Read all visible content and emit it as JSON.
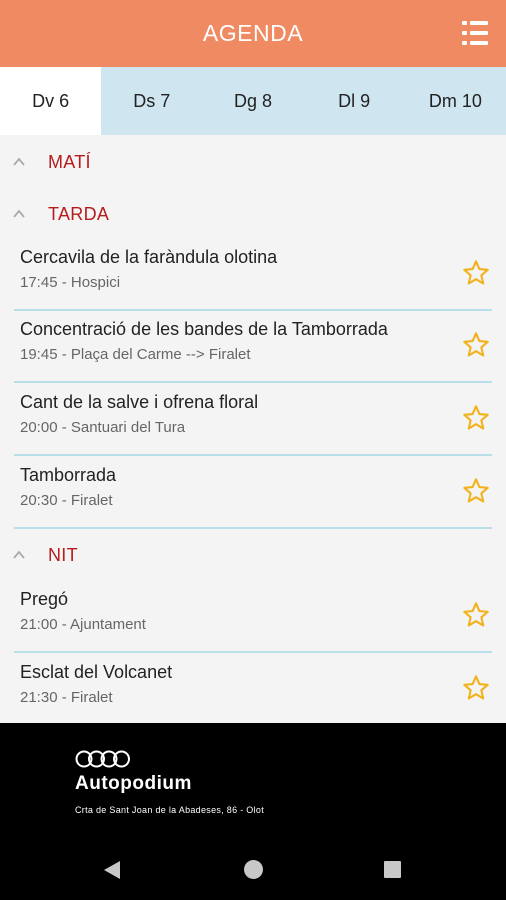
{
  "appbar": {
    "title": "AGENDA",
    "menu_icon": "list-menu-icon"
  },
  "tabs": [
    {
      "label": "Dv 6",
      "active": true
    },
    {
      "label": "Ds 7",
      "active": false
    },
    {
      "label": "Dg 8",
      "active": false
    },
    {
      "label": "Dl 9",
      "active": false
    },
    {
      "label": "Dm 10",
      "active": false
    }
  ],
  "sections": {
    "mati": {
      "label": "MATÍ"
    },
    "tarda": {
      "label": "TARDA"
    },
    "nit": {
      "label": "NIT"
    }
  },
  "events": [
    {
      "title": "Cercavila de la faràndula olotina",
      "subtitle": "17:45 - Hospici"
    },
    {
      "title": "Concentració de les bandes de la Tamborrada",
      "subtitle": "19:45 - Plaça del Carme --> Firalet"
    },
    {
      "title": "Cant de la salve i ofrena floral",
      "subtitle": "20:00 - Santuari del Tura"
    },
    {
      "title": "Tamborrada",
      "subtitle": "20:30 - Firalet"
    },
    {
      "title": "Pregó",
      "subtitle": "21:00 - Ajuntament"
    },
    {
      "title": "Esclat del Volcanet",
      "subtitle": "21:30 - Firalet"
    }
  ],
  "banner": {
    "brand": "Autopodium",
    "address": "Crta de Sant Joan de la Abadeses, 86 - Olot"
  },
  "colors": {
    "header": "#ef8a62",
    "tab_bar": "#cfe6f0",
    "section_label": "#b71c1c",
    "star": "#f2b21b",
    "divider": "#b9dde9"
  }
}
